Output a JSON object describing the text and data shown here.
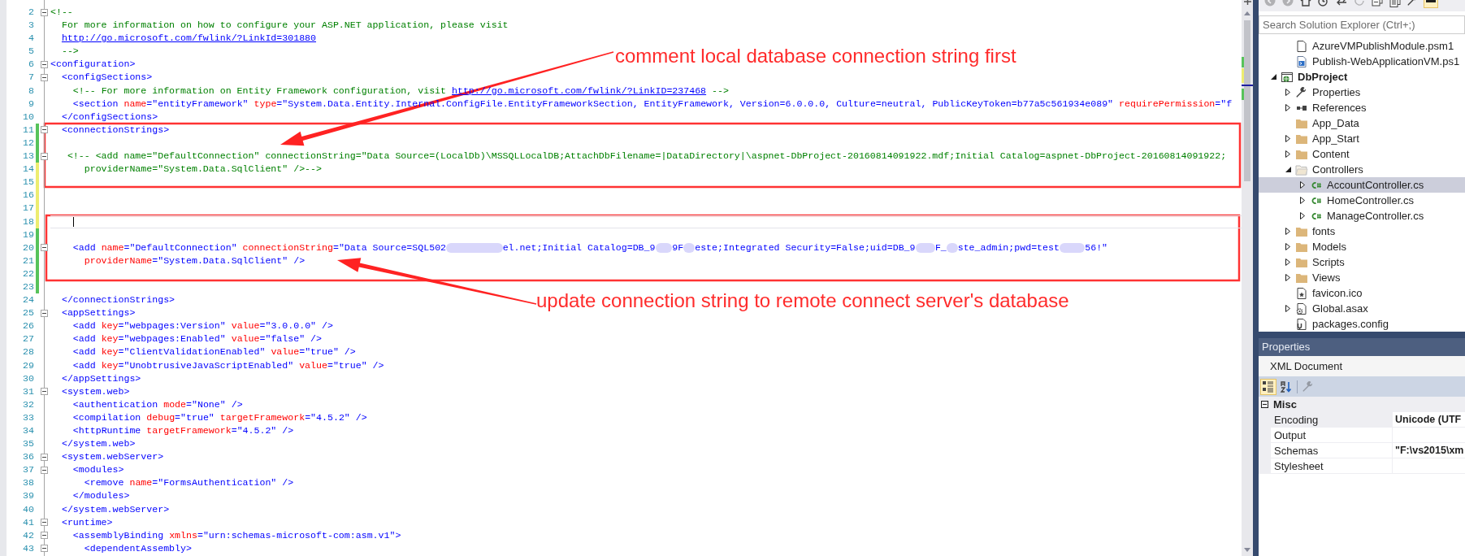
{
  "editor": {
    "lines": [
      {
        "number": "2",
        "fold": true,
        "caret": false,
        "modified": false,
        "segments": [
          {
            "kind": "comment",
            "text": "<!--"
          }
        ]
      },
      {
        "number": "3",
        "fold": false,
        "caret": false,
        "modified": false,
        "segments": [
          {
            "kind": "comment",
            "text": "  For more information on how to configure your ASP.NET application, please visit"
          }
        ]
      },
      {
        "number": "4",
        "fold": false,
        "caret": false,
        "modified": false,
        "segments": [
          {
            "kind": "link",
            "text": "  http://go.microsoft.com/fwlink/?LinkId=301880"
          }
        ]
      },
      {
        "number": "5",
        "fold": false,
        "caret": false,
        "modified": false,
        "segments": [
          {
            "kind": "comment",
            "text": "  -->"
          }
        ]
      },
      {
        "number": "6",
        "fold": true,
        "caret": false,
        "modified": false,
        "segments": [
          {
            "kind": "tag",
            "text": "<configuration>"
          }
        ]
      },
      {
        "number": "7",
        "fold": true,
        "caret": false,
        "modified": false,
        "segments": [
          {
            "kind": "tag",
            "text": "  <configSections>"
          }
        ]
      },
      {
        "number": "8",
        "fold": false,
        "caret": false,
        "modified": false,
        "segments": [
          {
            "kind": "comment",
            "text": "    <!-- For more information on Entity Framework configuration, visit "
          },
          {
            "kind": "link",
            "text": "http://go.microsoft.com/fwlink/?LinkID=237468"
          },
          {
            "kind": "comment",
            "text": " -->"
          }
        ]
      },
      {
        "number": "9",
        "fold": false,
        "caret": false,
        "modified": false,
        "segments": [
          {
            "kind": "tag",
            "text": "    <section "
          },
          {
            "kind": "attr",
            "text": "name"
          },
          {
            "kind": "tag",
            "text": "=\"entityFramework\" "
          },
          {
            "kind": "attr",
            "text": "type"
          },
          {
            "kind": "tag",
            "text": "=\"System.Data.Entity.Internal.ConfigFile.EntityFrameworkSection, EntityFramework, Version=6.0.0.0, Culture=neutral, PublicKeyToken=b77a5c561934e089\" "
          },
          {
            "kind": "attr",
            "text": "requirePermission"
          },
          {
            "kind": "tag",
            "text": "=\"f"
          }
        ]
      },
      {
        "number": "10",
        "fold": false,
        "caret": false,
        "modified": false,
        "segments": [
          {
            "kind": "tag",
            "text": "  </configSections>"
          }
        ]
      },
      {
        "number": "11",
        "fold": true,
        "caret": false,
        "modified": true,
        "saved": true,
        "segments": [
          {
            "kind": "tag",
            "text": "  <connectionStrings>"
          }
        ]
      },
      {
        "number": "12",
        "fold": false,
        "caret": false,
        "modified": true,
        "saved": true
      },
      {
        "number": "13",
        "fold": true,
        "caret": false,
        "modified": true,
        "saved": true,
        "segments": [
          {
            "kind": "comment",
            "text": "   <!-- <add name=\"DefaultConnection\" connectionString=\"Data Source=(LocalDb)\\MSSQLLocalDB;AttachDbFilename=|DataDirectory|\\aspnet-DbProject-20160814091922.mdf;Initial Catalog=aspnet-DbProject-20160814091922;"
          }
        ]
      },
      {
        "number": "14",
        "fold": false,
        "caret": false,
        "modified": true,
        "saved": false,
        "segments": [
          {
            "kind": "comment",
            "text": "      providerName=\"System.Data.SqlClient\" />-->"
          }
        ]
      },
      {
        "number": "15",
        "fold": false,
        "caret": false,
        "modified": true,
        "saved": false
      },
      {
        "number": "16",
        "fold": false,
        "caret": false,
        "modified": true,
        "saved": false
      },
      {
        "number": "17",
        "fold": false,
        "caret": false,
        "modified": true,
        "saved": false
      },
      {
        "number": "18",
        "fold": false,
        "caret": true,
        "modified": true,
        "saved": false
      },
      {
        "number": "19",
        "fold": false,
        "caret": false,
        "modified": true,
        "saved": true
      },
      {
        "number": "20",
        "fold": true,
        "caret": false,
        "modified": true,
        "saved": true,
        "segments": [
          {
            "kind": "tag",
            "text": "    <add "
          },
          {
            "kind": "attr",
            "text": "name"
          },
          {
            "kind": "tag",
            "text": "=\"DefaultConnection\" "
          },
          {
            "kind": "attr",
            "text": "connectionString"
          },
          {
            "kind": "tag",
            "text": "=\"Data Source=SQL502"
          },
          {
            "kind": "redacted"
          },
          {
            "kind": "tag",
            "text": "el.net;Initial Catalog=DB_9"
          },
          {
            "kind": "redacted"
          },
          {
            "kind": "tag",
            "text": "9F"
          },
          {
            "kind": "redacted"
          },
          {
            "kind": "tag",
            "text": "este;Integrated Security=False;uid=DB_9"
          },
          {
            "kind": "redacted"
          },
          {
            "kind": "tag",
            "text": "F_"
          },
          {
            "kind": "redacted"
          },
          {
            "kind": "tag",
            "text": "ste_admin;pwd=test"
          },
          {
            "kind": "redacted"
          },
          {
            "kind": "tag",
            "text": "56!\""
          }
        ]
      },
      {
        "number": "21",
        "fold": false,
        "caret": false,
        "modified": true,
        "saved": true,
        "segments": [
          {
            "kind": "attr",
            "text": "      providerName"
          },
          {
            "kind": "tag",
            "text": "=\"System.Data.SqlClient\" />"
          }
        ]
      },
      {
        "number": "22",
        "fold": false,
        "caret": false,
        "modified": true,
        "saved": true
      },
      {
        "number": "23",
        "fold": false,
        "caret": false,
        "modified": true,
        "saved": true
      },
      {
        "number": "24",
        "fold": false,
        "caret": false,
        "modified": false,
        "segments": [
          {
            "kind": "tag",
            "text": "  </connectionStrings>"
          }
        ]
      },
      {
        "number": "25",
        "fold": true,
        "caret": false,
        "modified": false,
        "segments": [
          {
            "kind": "tag",
            "text": "  <appSettings>"
          }
        ]
      },
      {
        "number": "26",
        "fold": false,
        "caret": false,
        "modified": false,
        "segments": [
          {
            "kind": "tag",
            "text": "    <add "
          },
          {
            "kind": "attr",
            "text": "key"
          },
          {
            "kind": "tag",
            "text": "=\"webpages:Version\" "
          },
          {
            "kind": "attr",
            "text": "value"
          },
          {
            "kind": "tag",
            "text": "=\"3.0.0.0\" />"
          }
        ]
      },
      {
        "number": "27",
        "fold": false,
        "caret": false,
        "modified": false,
        "segments": [
          {
            "kind": "tag",
            "text": "    <add "
          },
          {
            "kind": "attr",
            "text": "key"
          },
          {
            "kind": "tag",
            "text": "=\"webpages:Enabled\" "
          },
          {
            "kind": "attr",
            "text": "value"
          },
          {
            "kind": "tag",
            "text": "=\"false\" />"
          }
        ]
      },
      {
        "number": "28",
        "fold": false,
        "caret": false,
        "modified": false,
        "segments": [
          {
            "kind": "tag",
            "text": "    <add "
          },
          {
            "kind": "attr",
            "text": "key"
          },
          {
            "kind": "tag",
            "text": "=\"ClientValidationEnabled\" "
          },
          {
            "kind": "attr",
            "text": "value"
          },
          {
            "kind": "tag",
            "text": "=\"true\" />"
          }
        ]
      },
      {
        "number": "29",
        "fold": false,
        "caret": false,
        "modified": false,
        "segments": [
          {
            "kind": "tag",
            "text": "    <add "
          },
          {
            "kind": "attr",
            "text": "key"
          },
          {
            "kind": "tag",
            "text": "=\"UnobtrusiveJavaScriptEnabled\" "
          },
          {
            "kind": "attr",
            "text": "value"
          },
          {
            "kind": "tag",
            "text": "=\"true\" />"
          }
        ]
      },
      {
        "number": "30",
        "fold": false,
        "caret": false,
        "modified": false,
        "segments": [
          {
            "kind": "tag",
            "text": "  </appSettings>"
          }
        ]
      },
      {
        "number": "31",
        "fold": true,
        "caret": false,
        "modified": false,
        "segments": [
          {
            "kind": "tag",
            "text": "  <system.web>"
          }
        ]
      },
      {
        "number": "32",
        "fold": false,
        "caret": false,
        "modified": false,
        "segments": [
          {
            "kind": "tag",
            "text": "    <authentication "
          },
          {
            "kind": "attr",
            "text": "mode"
          },
          {
            "kind": "tag",
            "text": "=\"None\" />"
          }
        ]
      },
      {
        "number": "33",
        "fold": false,
        "caret": false,
        "modified": false,
        "segments": [
          {
            "kind": "tag",
            "text": "    <compilation "
          },
          {
            "kind": "attr",
            "text": "debug"
          },
          {
            "kind": "tag",
            "text": "=\"true\" "
          },
          {
            "kind": "attr",
            "text": "targetFramework"
          },
          {
            "kind": "tag",
            "text": "=\"4.5.2\" />"
          }
        ]
      },
      {
        "number": "34",
        "fold": false,
        "caret": false,
        "modified": false,
        "segments": [
          {
            "kind": "tag",
            "text": "    <httpRuntime "
          },
          {
            "kind": "attr",
            "text": "targetFramework"
          },
          {
            "kind": "tag",
            "text": "=\"4.5.2\" />"
          }
        ]
      },
      {
        "number": "35",
        "fold": false,
        "caret": false,
        "modified": false,
        "segments": [
          {
            "kind": "tag",
            "text": "  </system.web>"
          }
        ]
      },
      {
        "number": "36",
        "fold": true,
        "caret": false,
        "modified": false,
        "segments": [
          {
            "kind": "tag",
            "text": "  <system.webServer>"
          }
        ]
      },
      {
        "number": "37",
        "fold": true,
        "caret": false,
        "modified": false,
        "segments": [
          {
            "kind": "tag",
            "text": "    <modules>"
          }
        ]
      },
      {
        "number": "38",
        "fold": false,
        "caret": false,
        "modified": false,
        "segments": [
          {
            "kind": "tag",
            "text": "      <remove "
          },
          {
            "kind": "attr",
            "text": "name"
          },
          {
            "kind": "tag",
            "text": "=\"FormsAuthentication\" />"
          }
        ]
      },
      {
        "number": "39",
        "fold": false,
        "caret": false,
        "modified": false,
        "segments": [
          {
            "kind": "tag",
            "text": "    </modules>"
          }
        ]
      },
      {
        "number": "40",
        "fold": false,
        "caret": false,
        "modified": false,
        "segments": [
          {
            "kind": "tag",
            "text": "  </system.webServer>"
          }
        ]
      },
      {
        "number": "41",
        "fold": true,
        "caret": false,
        "modified": false,
        "segments": [
          {
            "kind": "tag",
            "text": "  <runtime>"
          }
        ]
      },
      {
        "number": "42",
        "fold": true,
        "caret": false,
        "modified": false,
        "segments": [
          {
            "kind": "tag",
            "text": "    <assemblyBinding "
          },
          {
            "kind": "attr",
            "text": "xmlns"
          },
          {
            "kind": "tag",
            "text": "=\"urn:schemas-microsoft-com:asm.v1\">"
          }
        ]
      },
      {
        "number": "43",
        "fold": true,
        "caret": false,
        "modified": false,
        "segments": [
          {
            "kind": "tag",
            "text": "      <dependentAssembly>"
          }
        ]
      }
    ]
  },
  "annotations": [
    {
      "text": "comment local database connection string first"
    },
    {
      "text": "update connection string to remote connect server's database"
    }
  ],
  "solution_explorer": {
    "toolbar": [
      {
        "kind": "back",
        "disabled": true,
        "on": false
      },
      {
        "kind": "forward",
        "disabled": true,
        "on": false
      },
      {
        "kind": "home",
        "disabled": false,
        "on": false
      },
      {
        "kind": "history",
        "disabled": false,
        "on": false
      },
      {
        "kind": "sync",
        "disabled": false,
        "on": false
      },
      {
        "kind": "refresh",
        "disabled": true,
        "on": false
      },
      {
        "kind": "collapse",
        "disabled": false,
        "on": false
      },
      {
        "kind": "show-files",
        "disabled": false,
        "on": false
      },
      {
        "kind": "wrench",
        "disabled": false,
        "on": false
      },
      {
        "kind": "preview",
        "disabled": false,
        "on": true
      }
    ],
    "search": {
      "placeholder": "Search Solution Explorer (Ctrl+;)"
    },
    "items": [
      {
        "children": [
          {
            "label": "AzureVMPublishModule.psm1",
            "kind": "file",
            "selected": false
          },
          {
            "label": "Publish-WebApplicationVM.ps1",
            "kind": "script",
            "selected": false
          }
        ]
      },
      {
        "label": "DbProject",
        "kind": "project",
        "expanded": true,
        "selected": false,
        "children": [
          {
            "label": "Properties",
            "kind": "wrench",
            "expanded": false,
            "selected": false
          },
          {
            "label": "References",
            "kind": "references",
            "expanded": false,
            "selected": false
          },
          {
            "label": "App_Data",
            "kind": "folder",
            "selected": false
          },
          {
            "label": "App_Start",
            "kind": "folder",
            "expanded": false,
            "selected": false
          },
          {
            "label": "Content",
            "kind": "folder",
            "expanded": false,
            "selected": false
          },
          {
            "label": "Controllers",
            "kind": "folder-open",
            "expanded": true,
            "selected": false,
            "children": [
              {
                "label": "AccountController.cs",
                "kind": "csharp",
                "expanded": false,
                "selected": true
              },
              {
                "label": "HomeController.cs",
                "kind": "csharp",
                "expanded": false,
                "selected": false
              },
              {
                "label": "ManageController.cs",
                "kind": "csharp",
                "expanded": false,
                "selected": false
              }
            ]
          },
          {
            "label": "fonts",
            "kind": "folder",
            "expanded": false,
            "selected": false
          },
          {
            "label": "Models",
            "kind": "folder",
            "expanded": false,
            "selected": false
          },
          {
            "label": "Scripts",
            "kind": "folder",
            "expanded": false,
            "selected": false
          },
          {
            "label": "Views",
            "kind": "folder",
            "expanded": false,
            "selected": false
          },
          {
            "label": "favicon.ico",
            "kind": "image",
            "selected": false
          },
          {
            "label": "Global.asax",
            "kind": "gear-file",
            "expanded": false,
            "selected": false
          },
          {
            "label": "packages.config",
            "kind": "config",
            "selected": false
          }
        ]
      }
    ]
  },
  "properties": {
    "title": "Properties",
    "object": "XML Document",
    "toolbar": [
      {
        "kind": "categorized",
        "selected": true,
        "disabled": false
      },
      {
        "kind": "alphabetical",
        "selected": false,
        "disabled": false
      },
      {
        "kind": "property-pages",
        "selected": false,
        "disabled": true
      }
    ],
    "category": {
      "name": "Misc",
      "expanded": true
    },
    "rows": [
      {
        "name": "Encoding",
        "value": "Unicode (UTF",
        "selected": true
      },
      {
        "name": "Output",
        "selected": false
      },
      {
        "name": "Schemas",
        "value": "\"F:\\vs2015\\xm",
        "selected": false
      },
      {
        "name": "Stylesheet",
        "selected": false
      }
    ]
  }
}
